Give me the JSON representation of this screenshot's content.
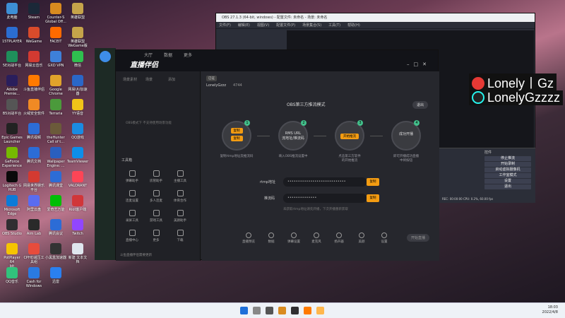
{
  "desktop_icons": [
    {
      "label": "此电脑",
      "color": "#3d8fd6"
    },
    {
      "label": "Steam",
      "color": "#1b2838"
    },
    {
      "label": "Counter-S\nGlobal Off...",
      "color": "#d98b1f"
    },
    {
      "label": "英雄联盟",
      "color": "#c5a44a"
    },
    {
      "label": "15TPLAYER",
      "color": "#2b6dd1"
    },
    {
      "label": "WeGame",
      "color": "#d94b2b"
    },
    {
      "label": "FACEIT",
      "color": "#ff6a00"
    },
    {
      "label": "英雄联盟\nWeGame版",
      "color": "#c5a44a"
    },
    {
      "label": "5E对战平台",
      "color": "#1f8f5b"
    },
    {
      "label": "网易云音乐",
      "color": "#d33a31"
    },
    {
      "label": "GXD VPN",
      "color": "#3e80d9"
    },
    {
      "label": "微信",
      "color": "#2fbf4f"
    },
    {
      "label": "Adobe\nPremie...",
      "color": "#2a1e5c"
    },
    {
      "label": "斗鱼直播伴侣",
      "color": "#ff7a00"
    },
    {
      "label": "Google\nChrome",
      "color": "#e0a32b"
    },
    {
      "label": "网易UU加速器",
      "color": "#2a67c7"
    },
    {
      "label": "B5对战平台",
      "color": "#555"
    },
    {
      "label": "火绒安全软件",
      "color": "#f08a24"
    },
    {
      "label": "Terraria",
      "color": "#4b9a3b"
    },
    {
      "label": "YY语音",
      "color": "#f0c419"
    },
    {
      "label": "Epic Games\nLauncher",
      "color": "#222"
    },
    {
      "label": "腾讯视频",
      "color": "#2c6cd6"
    },
    {
      "label": "theHunter\nCall of t...",
      "color": "#6b5a3a"
    },
    {
      "label": "QQ游戏",
      "color": "#1a8be2"
    },
    {
      "label": "GeForce\nExperience",
      "color": "#76b900"
    },
    {
      "label": "腾讯文档",
      "color": "#2c6cd6"
    },
    {
      "label": "Wallpaper\nEngine: ...",
      "color": "#2a5fbf"
    },
    {
      "label": "TeamViewer",
      "color": "#0e8ee9"
    },
    {
      "label": "Logitech G\nHUB",
      "color": "#0a0a0a"
    },
    {
      "label": "网易世界娱乐\n平台",
      "color": "#d33a31"
    },
    {
      "label": "腾讯课堂",
      "color": "#2c6cd6"
    },
    {
      "label": "VALORANT",
      "color": "#fd4556"
    },
    {
      "label": "Microsoft\nEdge",
      "color": "#0c7bd8"
    },
    {
      "label": "阿里云盘",
      "color": "#5a6cf0"
    },
    {
      "label": "爱奇艺万能",
      "color": "#00be06"
    },
    {
      "label": "Riot客户端",
      "color": "#d13639"
    },
    {
      "label": "OBS Studio",
      "color": "#302e31"
    },
    {
      "label": "Aim Lab",
      "color": "#2a2a2a"
    },
    {
      "label": "腾讯会议",
      "color": "#2c6cd6"
    },
    {
      "label": "Twitch",
      "color": "#9146ff"
    },
    {
      "label": "PotPlayer 64\nbit",
      "color": "#f5c400"
    },
    {
      "label": "CPHD减压工\n具组",
      "color": "#e74c3c"
    },
    {
      "label": "小黑盒加速器",
      "color": "#333"
    },
    {
      "label": "新建 文本文\n档",
      "color": "#dfe6ee"
    },
    {
      "label": "QQ音乐",
      "color": "#31c27c"
    },
    {
      "label": "Cash for\nWindows",
      "color": "#2a7ae2"
    },
    {
      "label": "迅雷",
      "color": "#2a80f0"
    }
  ],
  "obs": {
    "title": "OBS 27.1.3 (64-bit, windows) - 配置文件: 未命名 - 场景: 未命名",
    "menu": [
      "文件(F)",
      "编辑(E)",
      "视图(V)",
      "配置文件(P)",
      "场景集合(S)",
      "工具(T)",
      "帮助(H)"
    ],
    "dock": {
      "header": "控件",
      "controls": [
        "停止推流",
        "开始录制",
        "启动虚拟摄像机",
        "工作室模式",
        "设置",
        "退出"
      ]
    },
    "status": "REC: 00:00:00   CPU: 0.2%, 60.00 fps"
  },
  "overlay": {
    "line1": "Lonely丨Gz",
    "line2": "LonelyGzzzz",
    "brand_color": "#e53935"
  },
  "app": {
    "logo": "直播伴侣",
    "nav_tabs": [
      "大厅",
      "数据",
      "更多"
    ],
    "left_tabs": [
      "场景素材",
      "场景",
      "添加"
    ],
    "left_hint": "OBS模式下 不支持使用场景功能",
    "tools_title": "工具箱",
    "tools": [
      "弹幕助手",
      "房管助手",
      "主播工具",
      "连麦设置",
      "多人连麦",
      "体育合作",
      "录屏工具",
      "游戏工具",
      "美颜助手",
      "直播中心",
      "更多",
      "下载"
    ],
    "footer": "斗鱼直播伴侣需要更新",
    "room": {
      "badge": "已证",
      "user": "LonelyGzzz",
      "views": "4744"
    },
    "mode_title": "OBS第三方推流模式",
    "exit": "退出",
    "steps": [
      {
        "num": "1",
        "center": "",
        "pills": [
          "复制",
          "复制"
        ],
        "desc": "复制rtmp地址及推流码"
      },
      {
        "num": "2",
        "center": "RMS URL\n流地址/推流码",
        "pills": [],
        "desc": "填入OBS推流设置中"
      },
      {
        "num": "3",
        "center": "",
        "pills": [
          "开始推流"
        ],
        "desc": "点击第三方软件\n的开始推流"
      },
      {
        "num": "4",
        "center": "成功开播",
        "pills": [],
        "desc": "即可开播成功直播\n中将按钮"
      }
    ],
    "rtmp_label": "rtmp地址",
    "rtmp_value": "••••••••••••••••••••••••••••",
    "code_label": "推流码",
    "code_value": "••••••••••••••",
    "copy": "复制",
    "note": "未获取rtmp地址请先开播，下次开播重新获取",
    "bottom_tools": [
      "直播预览",
      "数据",
      "弹幕设置",
      "麦克风",
      "扬声器",
      "美颜",
      "设置"
    ],
    "live_btn": "开始直播"
  },
  "taskbar": {
    "time": "18:03",
    "date": "2022/4/8"
  }
}
